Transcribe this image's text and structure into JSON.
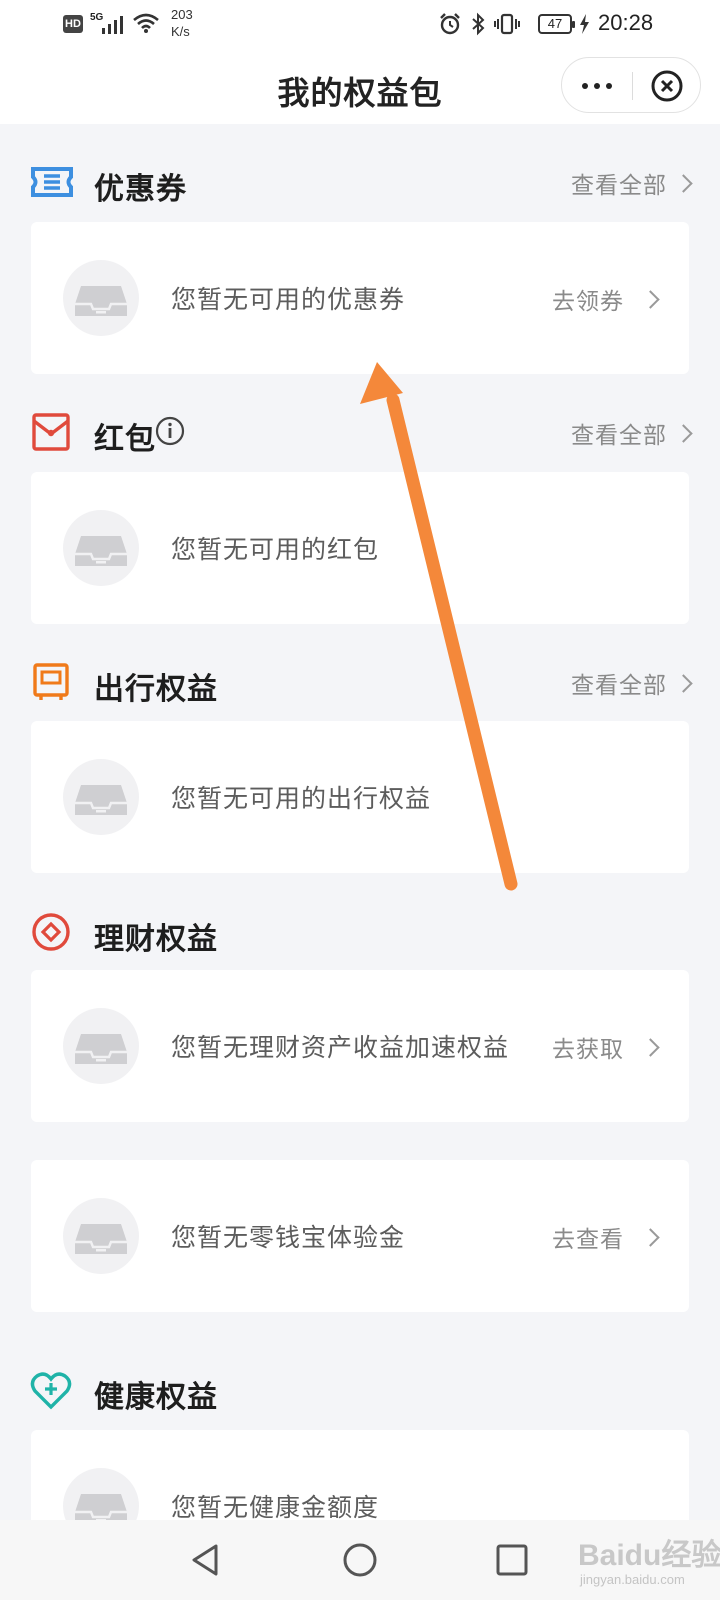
{
  "status_bar": {
    "hd": "HD",
    "network": "5G",
    "speed_value": "203",
    "speed_unit": "K/s",
    "battery": "47",
    "time": "20:28"
  },
  "header": {
    "title": "我的权益包"
  },
  "sections": {
    "coupon": {
      "title": "优惠券",
      "view_all": "查看全部",
      "empty_text": "您暂无可用的优惠券",
      "action": "去领券",
      "accent": "#3d8fe0"
    },
    "redpacket": {
      "title": "红包",
      "view_all": "查看全部",
      "empty_text": "您暂无可用的红包",
      "accent": "#e04a3c"
    },
    "travel": {
      "title": "出行权益",
      "view_all": "查看全部",
      "empty_text": "您暂无可用的出行权益",
      "accent": "#f07a1a"
    },
    "finance": {
      "title": "理财权益",
      "accent": "#e04a3c",
      "cards": [
        {
          "empty_text": "您暂无理财资产收益加速权益",
          "action": "去获取"
        },
        {
          "empty_text": "您暂无零钱宝体验金",
          "action": "去查看"
        }
      ]
    },
    "health": {
      "title": "健康权益",
      "empty_text": "您暂无健康金额度",
      "accent": "#1fb3a8"
    }
  },
  "annotation": {
    "arrow_color": "#f4883a"
  },
  "watermark": {
    "brand": "Baidu经验",
    "url": "jingyan.baidu.com"
  }
}
